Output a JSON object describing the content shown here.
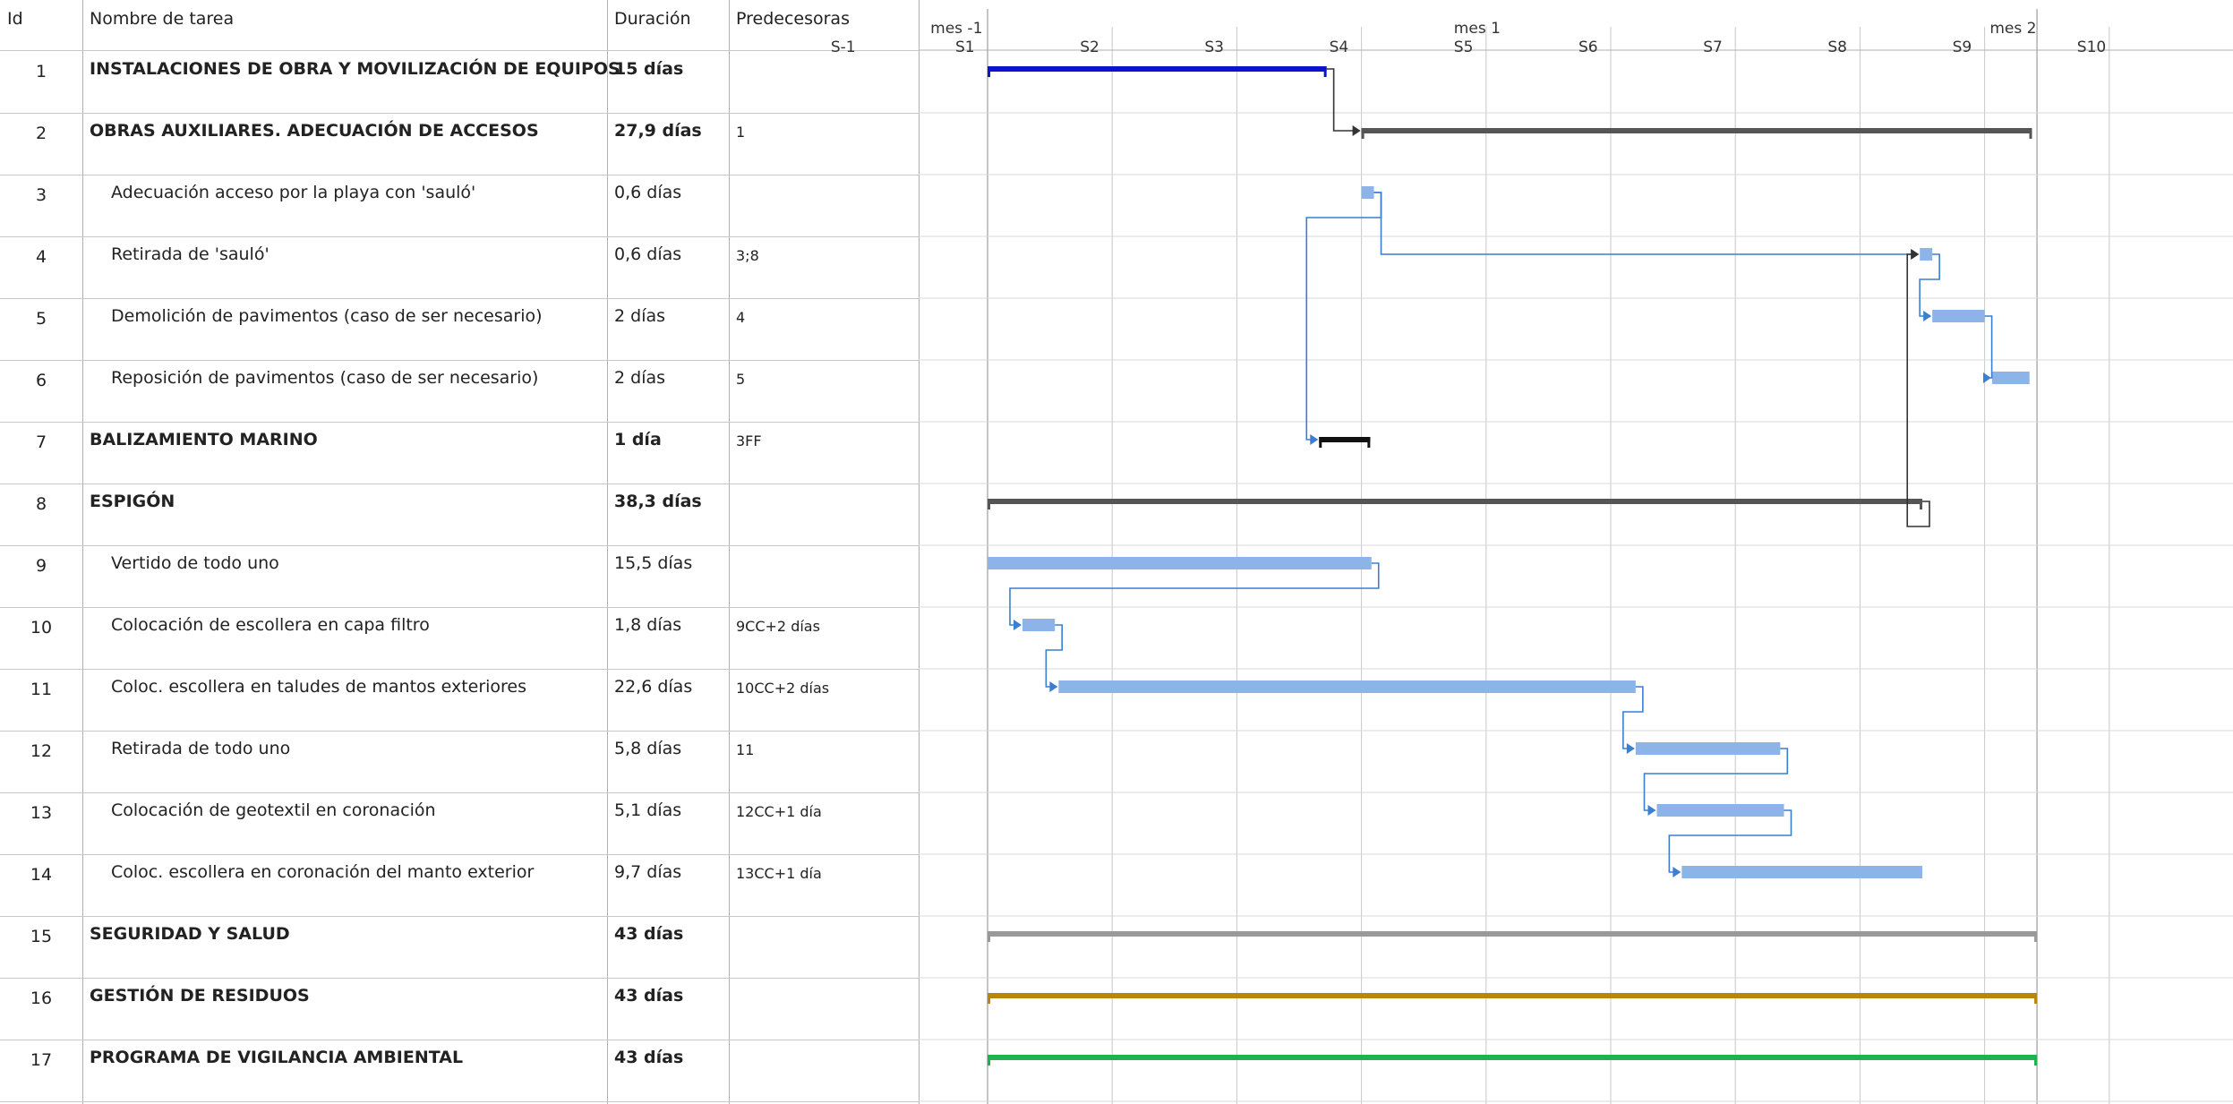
{
  "header": {
    "id": "Id",
    "name": "Nombre de tarea",
    "duration": "Duración",
    "predecessors": "Predecesoras"
  },
  "timescale": {
    "months": [
      "mes -1",
      "mes 1",
      "mes 2"
    ],
    "weeks": [
      "S-1",
      "S1",
      "S2",
      "S3",
      "S4",
      "S5",
      "S6",
      "S7",
      "S8",
      "S9",
      "S10"
    ]
  },
  "tasks": [
    {
      "id": "1",
      "name": "INSTALACIONES DE OBRA Y MOVILIZACIÓN DE EQUIPOS",
      "duration": "15 días",
      "pred": "",
      "summary": true,
      "start": 0,
      "end": 2.72,
      "color": "#0a14c8"
    },
    {
      "id": "2",
      "name": "OBRAS AUXILIARES. ADECUACIÓN DE ACCESOS",
      "duration": "27,9 días",
      "pred": "1",
      "summary": true,
      "start": 3.0,
      "end": 8.38,
      "color": "#555555"
    },
    {
      "id": "3",
      "name": "Adecuación acceso por la playa con 'sauló'",
      "duration": "0,6 días",
      "pred": "",
      "summary": false,
      "start": 3.0,
      "end": 3.1,
      "color": "#8cb4e8"
    },
    {
      "id": "4",
      "name": "Retirada de 'sauló'",
      "duration": "0,6 días",
      "pred": "3;8",
      "summary": false,
      "start": 7.48,
      "end": 7.58,
      "color": "#8cb4e8"
    },
    {
      "id": "5",
      "name": "Demolición de pavimentos (caso de ser necesario)",
      "duration": "2 días",
      "pred": "4",
      "summary": false,
      "start": 7.58,
      "end": 8.0,
      "color": "#8cb4e8"
    },
    {
      "id": "6",
      "name": "Reposición de pavimentos (caso de ser necesario)",
      "duration": "2 días",
      "pred": "5",
      "summary": false,
      "start": 8.06,
      "end": 8.36,
      "color": "#8cb4e8"
    },
    {
      "id": "7",
      "name": "BALIZAMIENTO MARINO",
      "duration": "1 día",
      "pred": "3FF",
      "summary": true,
      "start": 2.66,
      "end": 3.07,
      "color": "#111111"
    },
    {
      "id": "8",
      "name": "ESPIGÓN",
      "duration": "38,3 días",
      "pred": "",
      "summary": true,
      "start": 0,
      "end": 7.5,
      "color": "#555555"
    },
    {
      "id": "9",
      "name": "Vertido de todo uno",
      "duration": "15,5 días",
      "pred": "",
      "summary": false,
      "start": 0,
      "end": 3.08,
      "color": "#8cb4e8"
    },
    {
      "id": "10",
      "name": "Colocación de escollera en capa filtro",
      "duration": "1,8 días",
      "pred": "9CC+2 días",
      "summary": false,
      "start": 0.28,
      "end": 0.54,
      "color": "#8cb4e8"
    },
    {
      "id": "11",
      "name": "Coloc. escollera en taludes de mantos exteriores",
      "duration": "22,6 días",
      "pred": "10CC+2 días",
      "summary": false,
      "start": 0.57,
      "end": 5.2,
      "color": "#8cb4e8"
    },
    {
      "id": "12",
      "name": "Retirada de todo uno",
      "duration": "5,8 días",
      "pred": "11",
      "summary": false,
      "start": 5.2,
      "end": 6.36,
      "color": "#8cb4e8"
    },
    {
      "id": "13",
      "name": "Colocación de geotextil en coronación",
      "duration": "5,1 días",
      "pred": "12CC+1 día",
      "summary": false,
      "start": 5.37,
      "end": 6.39,
      "color": "#8cb4e8"
    },
    {
      "id": "14",
      "name": "Coloc. escollera en coronación del manto exterior",
      "duration": "9,7 días",
      "pred": "13CC+1 día",
      "summary": false,
      "start": 5.57,
      "end": 7.5,
      "color": "#8cb4e8"
    },
    {
      "id": "15",
      "name": "SEGURIDAD Y SALUD",
      "duration": "43 días",
      "pred": "",
      "summary": true,
      "start": 0,
      "end": 8.42,
      "color": "#999999"
    },
    {
      "id": "16",
      "name": "GESTIÓN DE RESIDUOS",
      "duration": "43 días",
      "pred": "",
      "summary": true,
      "start": 0,
      "end": 8.42,
      "color": "#b8860b"
    },
    {
      "id": "17",
      "name": "PROGRAMA DE VIGILANCIA AMBIENTAL",
      "duration": "43 días",
      "pred": "",
      "summary": true,
      "start": 0,
      "end": 8.42,
      "color": "#1db24a"
    }
  ],
  "links": [
    [
      "1",
      "2"
    ],
    [
      "3",
      "4"
    ],
    [
      "3",
      "7"
    ],
    [
      "8",
      "4"
    ],
    [
      "4",
      "5"
    ],
    [
      "5",
      "6"
    ],
    [
      "9",
      "10"
    ],
    [
      "10",
      "11"
    ],
    [
      "11",
      "12"
    ],
    [
      "12",
      "13"
    ],
    [
      "13",
      "14"
    ]
  ],
  "colors": {
    "grid": "#c8c8c8",
    "link": "#3a7fd0",
    "link_dark": "#333333"
  }
}
